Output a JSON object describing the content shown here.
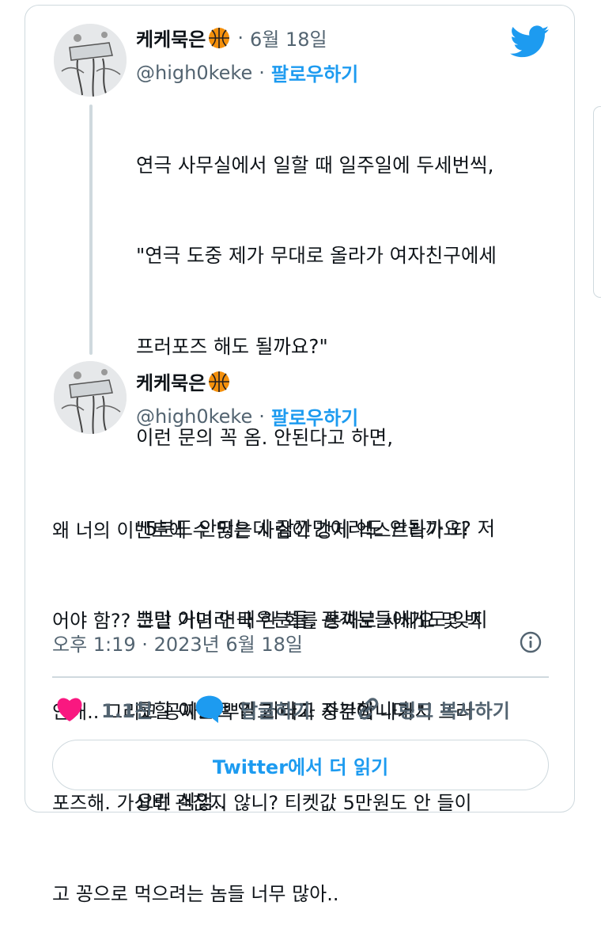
{
  "colors": {
    "accent": "#1d9bf0",
    "like": "#f91880",
    "text": "#0f1419",
    "muted": "#536471",
    "border": "#cfd9de"
  },
  "tweet1": {
    "display_name": "케케묵은",
    "emoji": "basketball-icon",
    "date": "6월 18일",
    "handle": "@high0keke",
    "follow": "팔로우하기",
    "lines": [
      "연극 사무실에서 일할 때 일주일에 두세번씩,",
      "\"연극 도중 제가 무대로 올라가 여자친구에세",
      "프러포즈 해도 될까요?\"",
      "이런 문의 꼭 옴. 안된다고 하면,",
      "\"5분도 안되는데 잠깐만이라도 안될까요? 저",
      "뿐만 아니라 배우분들, 관객분들에게도 잊지",
      "못할 이벤트 일 거라고 자부합니다.\"",
      "요런 식임.."
    ]
  },
  "tweet2": {
    "display_name": "케케묵은",
    "emoji": "basketball-icon",
    "handle": "@high0keke",
    "follow": "팔로우하기",
    "lines": [
      "왜 너의 이벤트에 수 많은 사람이 강제 엑스트라가 되",
      "어야 함?? 그럴 거면 연극 한 회를 통째로 사세요 몇 백",
      "안해.. 그리고 공짜표 뿌리고 니가 중간에 나가서 프러",
      "포즈해. 가성비 괜찮지 않니? 티켓값 5만원도 안 들이",
      "고 꽁으로 먹으려는 놈들 너무 많아.."
    ],
    "timestamp": "오후 1:19 · 2023년 6월 18일"
  },
  "actions": {
    "like_count": "1.1천",
    "reply_label": "답글하기",
    "copy_link_label": "링크 복사하기"
  },
  "read_more": "Twitter에서 더 읽기"
}
